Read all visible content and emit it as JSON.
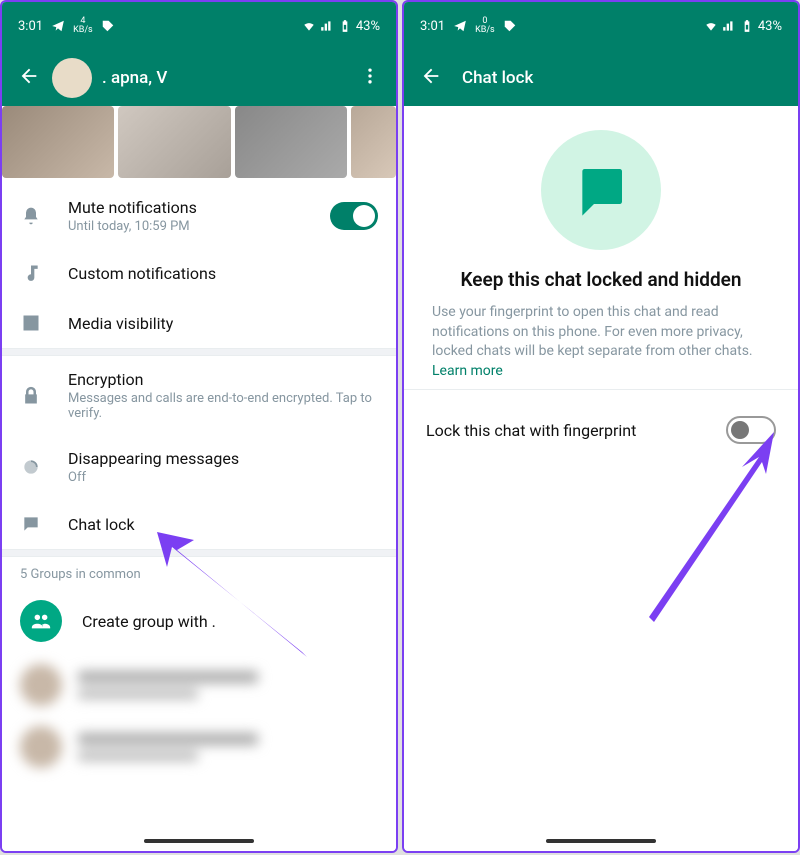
{
  "status": {
    "time": "3:01",
    "kbs_num": "4",
    "kbs_num2": "0",
    "kbs_unit": "KB/s",
    "battery": "43%"
  },
  "left": {
    "header_title": ". apna, V",
    "mute": {
      "label": "Mute notifications",
      "sub": "Until today, 10:59 PM"
    },
    "custom_notifications": "Custom notifications",
    "media_visibility": "Media visibility",
    "encryption": {
      "label": "Encryption",
      "sub": "Messages and calls are end-to-end encrypted. Tap to verify."
    },
    "disappearing": {
      "label": "Disappearing messages",
      "sub": "Off"
    },
    "chat_lock": "Chat lock",
    "groups_common": "5 Groups in common",
    "create_group": "Create group with ."
  },
  "right": {
    "header_title": "Chat lock",
    "hero_title": "Keep this chat locked and hidden",
    "hero_desc": "Use your fingerprint to open this chat and read notifications on this phone. For even more privacy, locked chats will be kept separate from other chats. ",
    "learn_more": "Learn more",
    "lock_label": "Lock this chat with fingerprint"
  }
}
